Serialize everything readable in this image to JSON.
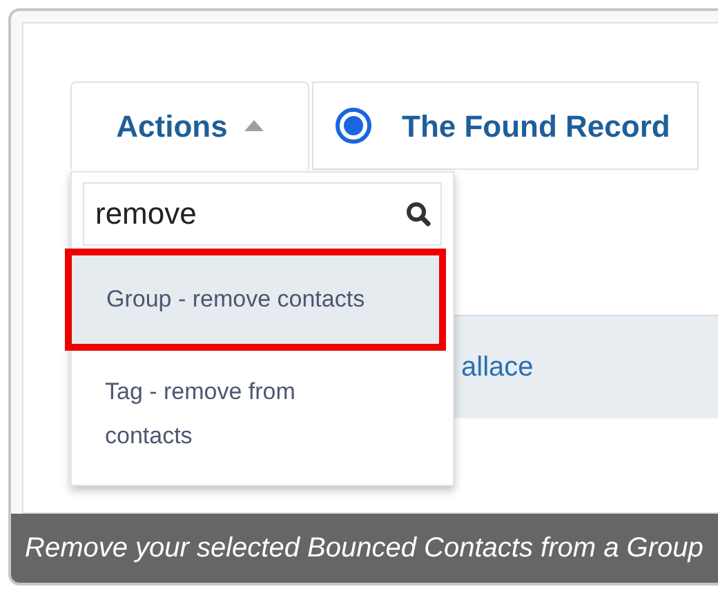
{
  "toolbar": {
    "actions_button": {
      "label": "Actions",
      "expanded": true
    },
    "tabs": [
      {
        "label": "The Found Record",
        "selected": true
      }
    ]
  },
  "search": {
    "value": "remove"
  },
  "menu_items": [
    {
      "label": "Group - remove contacts",
      "selected": true
    },
    {
      "label": "Tag - remove from contacts",
      "selected": false
    }
  ],
  "rows": [
    {
      "name": "allace"
    }
  ],
  "caption": "Remove your selected Bounced Contacts from a Group"
}
